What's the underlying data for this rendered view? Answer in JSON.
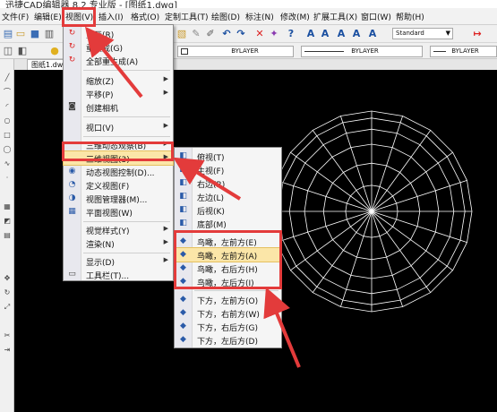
{
  "window": {
    "title": "迅捷CAD编辑器 8.2 专业版 - [图纸1.dwg]"
  },
  "menubar": {
    "items": [
      "文件(F)",
      "编辑(E)",
      "视图(V)",
      "插入(I)",
      "格式(O)",
      "定制工具(T)",
      "绘图(D)",
      "标注(N)",
      "修改(M)",
      "扩展工具(X)",
      "窗口(W)",
      "帮助(H)"
    ]
  },
  "toolbar": {
    "text_style": "Standard",
    "linetype_a": "BYLAYER",
    "linetype_b": "BYLAYER",
    "linetype_c": "BYLAYER"
  },
  "document": {
    "tab": "图纸1.dwg"
  },
  "view_menu": {
    "items": [
      {
        "label": "重画(R)",
        "icon": "redraw-icon"
      },
      {
        "label": "重生成(G)",
        "icon": "regen-icon"
      },
      {
        "label": "全部重生成(A)",
        "icon": "regen-all-icon"
      },
      {
        "label": "缩放(Z)",
        "submenu": true
      },
      {
        "label": "平移(P)",
        "submenu": true
      },
      {
        "label": "创建相机",
        "icon": "camera-icon"
      },
      {
        "label": "视口(V)",
        "submenu": true
      },
      {
        "label": "三维动态观察(B)",
        "submenu": true
      },
      {
        "label": "三维视图(3)",
        "submenu": true,
        "active": true
      },
      {
        "label": "动态视图控制(D)...",
        "icon": "dynamic-view-icon"
      },
      {
        "label": "定义视图(F)",
        "icon": "define-view-icon"
      },
      {
        "label": "视图管理器(M)...",
        "icon": "view-manager-icon"
      },
      {
        "label": "平面视图(W)",
        "icon": "plan-view-icon"
      },
      {
        "label": "视觉样式(Y)",
        "submenu": true
      },
      {
        "label": "渲染(N)",
        "submenu": true
      },
      {
        "label": "显示(D)",
        "submenu": true
      },
      {
        "label": "工具栏(T)...",
        "icon": "toolbar-icon"
      }
    ]
  },
  "view3d_menu": {
    "items": [
      {
        "label": "俯视(T)"
      },
      {
        "label": "主视(F)"
      },
      {
        "label": "右边(R)"
      },
      {
        "label": "左边(L)"
      },
      {
        "label": "后视(K)"
      },
      {
        "label": "底部(M)"
      },
      {
        "label": "鸟瞰，左前方(E)"
      },
      {
        "label": "鸟瞰，左前方(A)",
        "active": true
      },
      {
        "label": "鸟瞰，右后方(H)"
      },
      {
        "label": "鸟瞰，左后方(I)"
      },
      {
        "label": "下方，左前方(O)"
      },
      {
        "label": "下方，右前方(W)"
      },
      {
        "label": "下方，右后方(G)"
      },
      {
        "label": "下方，左后方(D)"
      }
    ]
  },
  "colors": {
    "annotation_red": "#e33b3b",
    "highlight": "#fbe6a8",
    "wireframe": "#ffffff",
    "canvas": "#000000"
  }
}
